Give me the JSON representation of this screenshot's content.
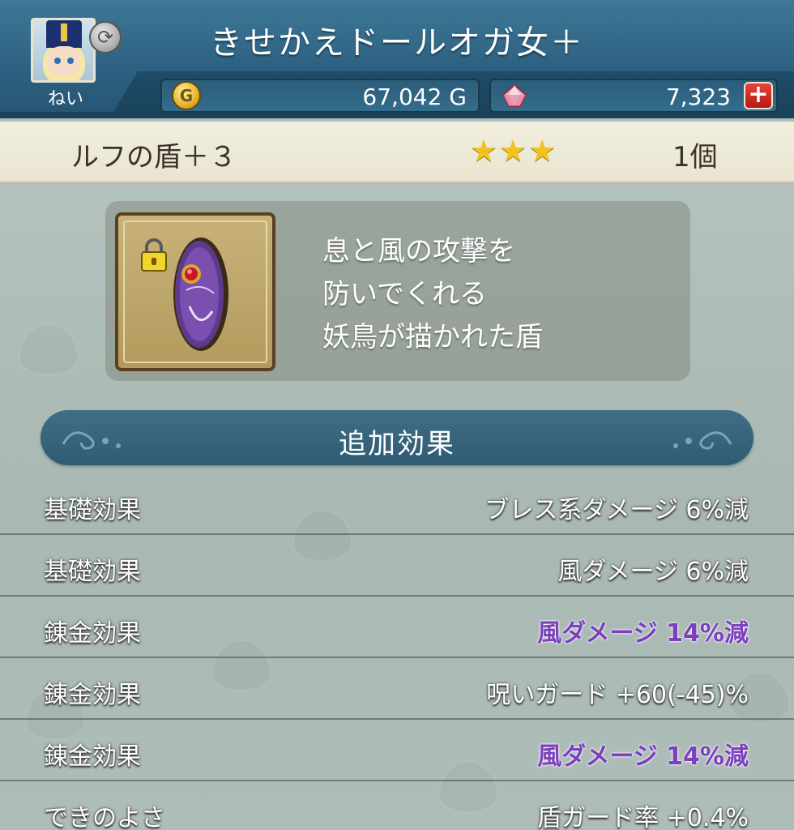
{
  "header": {
    "title": "きせかえドールオガ女＋",
    "player_name": "ねい",
    "gold_value": "67,042 G",
    "gem_value": "7,323",
    "plus_label": "+"
  },
  "item": {
    "name": "ルフの盾＋３",
    "stars": "★★★",
    "star_rating": 3,
    "count": "1個"
  },
  "description": {
    "lines": [
      "息と風の攻撃を",
      "防いでくれる",
      "妖鳥が描かれた盾"
    ]
  },
  "section": {
    "title": "追加効果"
  },
  "effects": [
    {
      "label": "基礎効果",
      "value": "ブレス系ダメージ 6%減",
      "highlight": false
    },
    {
      "label": "基礎効果",
      "value": "風ダメージ 6%減",
      "highlight": false
    },
    {
      "label": "錬金効果",
      "value": "風ダメージ 14%減",
      "highlight": true
    },
    {
      "label": "錬金効果",
      "value": "呪いガード +60(-45)%",
      "highlight": false
    },
    {
      "label": "錬金効果",
      "value": "風ダメージ 14%減",
      "highlight": true
    },
    {
      "label": "できのよさ",
      "value": "盾ガード率 +0.4%",
      "highlight": false
    }
  ],
  "colors": {
    "header_blue": "#2e6283",
    "item_bar": "#f2efe0",
    "star_gold": "#f2c21e",
    "highlight_purple": "#7b3fbf",
    "plus_red": "#d0302a"
  },
  "icons": {
    "swap": "swap-icon",
    "gold": "gold-coin-icon",
    "gem": "gem-icon",
    "lock": "lock-icon",
    "shield": "shield-icon"
  }
}
